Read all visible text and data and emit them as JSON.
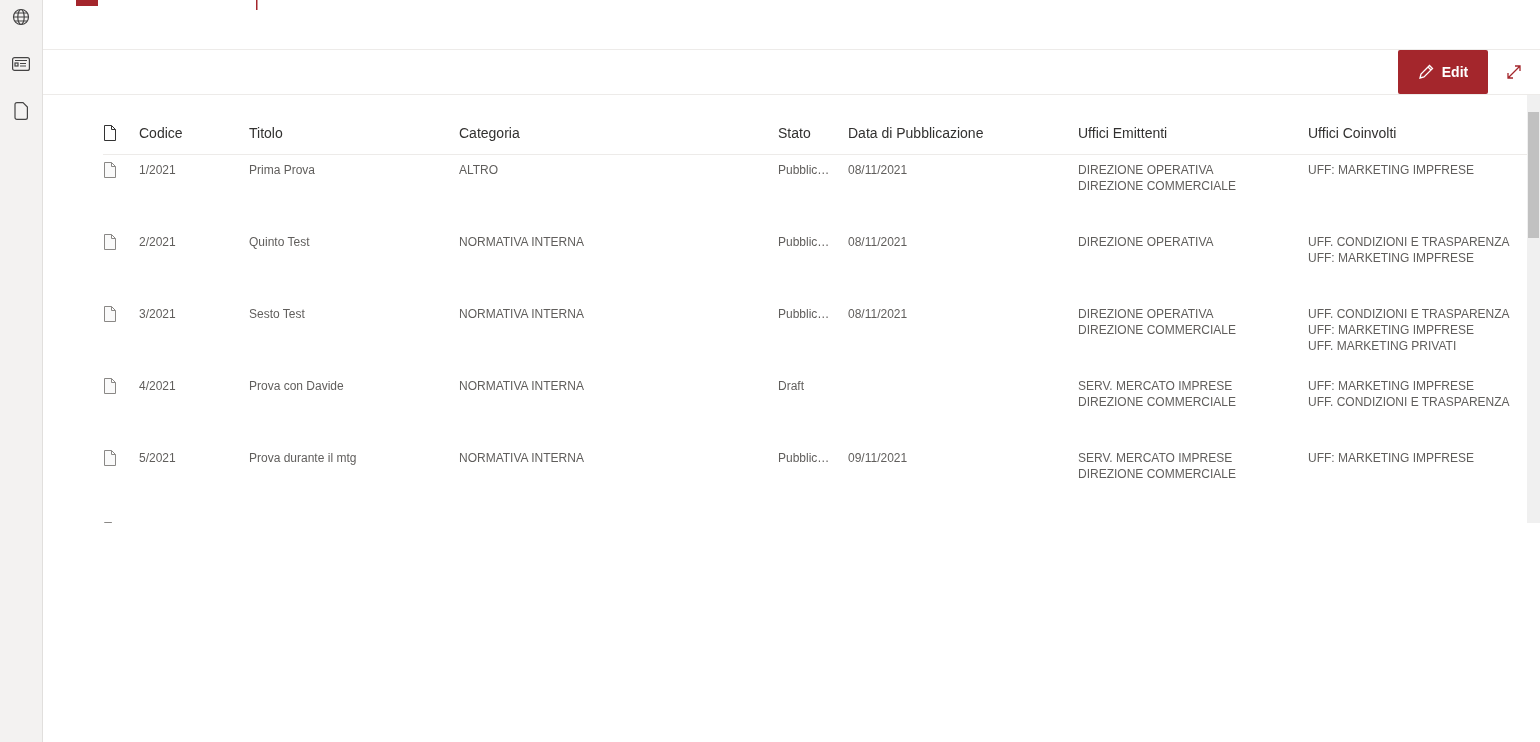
{
  "command_bar": {
    "edit_button": "Edit"
  },
  "table": {
    "columns": [
      "Codice",
      "Titolo",
      "Categoria",
      "Stato",
      "Data di Pubblicazione",
      "Uffici Emittenti",
      "Uffici Coinvolti"
    ],
    "rows": [
      {
        "codice": "1/2021",
        "titolo": "Prima Prova",
        "categoria": "ALTRO",
        "stato": "Pubblic…",
        "data": "08/11/2021",
        "emittenti": [
          "DIREZIONE OPERATIVA",
          "DIREZIONE COMMERCIALE"
        ],
        "coinvolti": [
          "UFF: MARKETING IMPFRESE"
        ]
      },
      {
        "codice": "2/2021",
        "titolo": "Quinto Test",
        "categoria": "NORMATIVA INTERNA",
        "stato": "Pubblic…",
        "data": "08/11/2021",
        "emittenti": [
          "DIREZIONE OPERATIVA"
        ],
        "coinvolti": [
          "UFF. CONDIZIONI E TRASPARENZA",
          "UFF: MARKETING IMPFRESE"
        ]
      },
      {
        "codice": "3/2021",
        "titolo": "Sesto Test",
        "categoria": "NORMATIVA INTERNA",
        "stato": "Pubblic…",
        "data": "08/11/2021",
        "emittenti": [
          "DIREZIONE OPERATIVA",
          "DIREZIONE COMMERCIALE"
        ],
        "coinvolti": [
          "UFF. CONDIZIONI E TRASPARENZA",
          "UFF: MARKETING IMPFRESE",
          "UFF. MARKETING PRIVATI"
        ]
      },
      {
        "codice": "4/2021",
        "titolo": "Prova con Davide",
        "categoria": "NORMATIVA INTERNA",
        "stato": "Draft",
        "emittenti": [
          "SERV. MERCATO IMPRESE",
          "DIREZIONE COMMERCIALE"
        ],
        "coinvolti": [
          "UFF: MARKETING IMPFRESE",
          "UFF. CONDIZIONI E TRASPARENZA"
        ]
      },
      {
        "codice": "5/2021",
        "titolo": "Prova durante il mtg",
        "categoria": "NORMATIVA INTERNA",
        "stato": "Pubblic…",
        "data": "09/11/2021",
        "emittenti": [
          "SERV. MERCATO IMPRESE",
          "DIREZIONE COMMERCIALE"
        ],
        "coinvolti": [
          "UFF: MARKETING IMPFRESE"
        ]
      }
    ]
  }
}
